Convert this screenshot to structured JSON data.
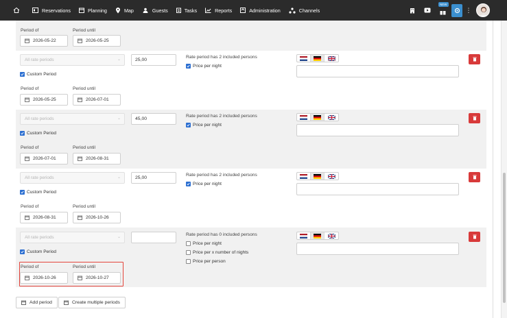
{
  "nav": {
    "items": [
      {
        "label": "Reservations",
        "icon": "reservations-icon"
      },
      {
        "label": "Planning",
        "icon": "calendar-icon"
      },
      {
        "label": "Map",
        "icon": "map-icon"
      },
      {
        "label": "Guests",
        "icon": "guests-icon"
      },
      {
        "label": "Tasks",
        "icon": "tasks-icon"
      },
      {
        "label": "Reports",
        "icon": "reports-icon"
      },
      {
        "label": "Administration",
        "icon": "administration-icon"
      },
      {
        "label": "Channels",
        "icon": "channels-icon"
      }
    ],
    "new_badge": "NEW"
  },
  "labels": {
    "period_of": "Period of",
    "period_until": "Period until",
    "custom_period": "Custom Period",
    "rate_select_placeholder": "All rate periods",
    "price_per_night": "Price per night",
    "price_per_x_nights": "Price per x number of nights",
    "price_per_person": "Price per person"
  },
  "top_period": {
    "from": "2026-05-22",
    "until": "2026-05-25"
  },
  "rows": [
    {
      "price": "25,00",
      "persons_text": "Rate period has 2  included persons",
      "from": "2026-05-25",
      "until": "2026-07-01"
    },
    {
      "price": "45,00",
      "persons_text": "Rate period has 2  included persons",
      "from": "2026-07-01",
      "until": "2026-08-31"
    },
    {
      "price": "25,00",
      "persons_text": "Rate period has 2  included persons",
      "from": "2026-08-31",
      "until": "2026-10-26"
    },
    {
      "price": "",
      "persons_text": "Rate period has 0  included persons",
      "from": "2026-10-26",
      "until": "2026-10-27"
    }
  ],
  "buttons": {
    "add_period": "Add period",
    "create_multiple": "Create multiple periods"
  },
  "colors": {
    "delete": "#d83a3a",
    "highlight": "#e3433a",
    "accent": "#3b8fcf"
  }
}
